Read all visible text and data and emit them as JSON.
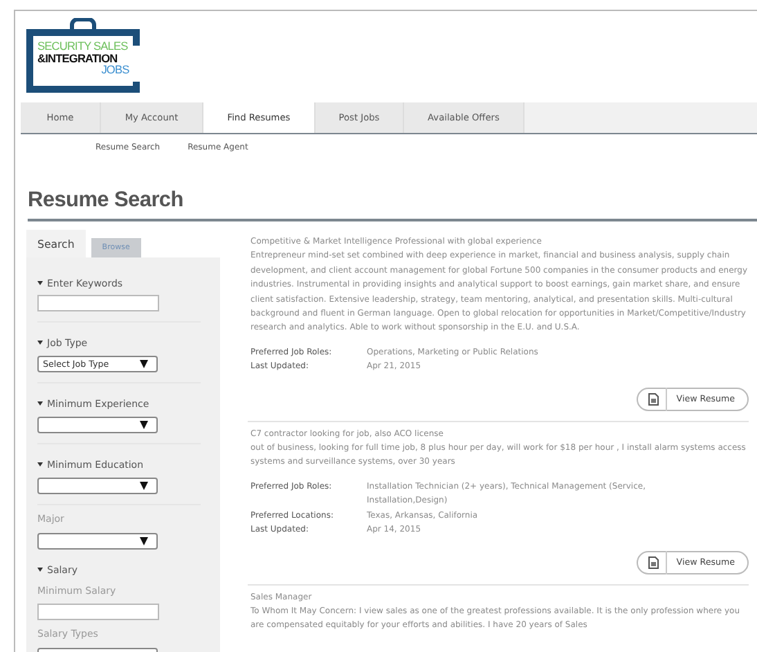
{
  "logo": {
    "line_1": "SECURITY SALES",
    "line_2": "&INTEGRATION",
    "line_3": "JOBS"
  },
  "nav": [
    {
      "label": "Home",
      "selected": false
    },
    {
      "label": "My Account",
      "selected": false
    },
    {
      "label": "Find Resumes",
      "selected": true
    },
    {
      "label": "Post Jobs",
      "selected": false
    },
    {
      "label": "Available Offers",
      "selected": false
    }
  ],
  "subnav": [
    "Resume Search",
    "Resume Agent"
  ],
  "title": "Resume Search",
  "sidebar": {
    "tabs": [
      {
        "label": "Search",
        "selected": true
      },
      {
        "label": "Browse",
        "selected": false
      }
    ],
    "fields": [
      {
        "kind": "section",
        "label": "Enter Keywords"
      },
      {
        "kind": "input"
      },
      {
        "kind": "section",
        "label": "Job Type"
      },
      {
        "kind": "select",
        "value": "Select Job Type"
      },
      {
        "kind": "section",
        "label": "Minimum Experience"
      },
      {
        "kind": "select"
      },
      {
        "kind": "section",
        "label": "Minimum Education"
      },
      {
        "kind": "select"
      },
      {
        "kind": "sub",
        "label": "Major"
      },
      {
        "kind": "select"
      },
      {
        "kind": "section",
        "label": "Salary"
      },
      {
        "kind": "sub",
        "label": "Minimum Salary"
      },
      {
        "kind": "input"
      },
      {
        "kind": "sub",
        "label": "Salary Types"
      },
      {
        "kind": "select"
      }
    ]
  },
  "results": [
    {
      "headline": "Competitive & Market Intelligence Professional with global experience",
      "summary": "Entrepreneur mind-set set combined with deep experience in market, financial and business analysis, supply chain development, and client account management for global Fortune 500 companies in the consumer products and energy industries. Instrumental in providing insights and analytical support to boost earnings, gain market share, and ensure client satisfaction. Extensive leadership, strategy, team mentoring, analytical, and presentation skills. Multi-cultural background and fluent in German language. Open to global relocation for opportunities in Market/Competitive/Industry research and analytics. Able to work without sponsorship in the E.U. and U.S.A.",
      "details": [
        {
          "label": "Preferred Job Roles:",
          "value": "Operations, Marketing or Public Relations"
        },
        {
          "label": "Last Updated:",
          "value": "Apr 21, 2015"
        }
      ],
      "button": "View Resume"
    },
    {
      "headline": "C7 contractor looking for job, also ACO license",
      "summary": "out of business, looking for full time job, 8 plus hour per day, will work for $18 per hour , I install alarm systems access systems and surveillance systems, over 30 years",
      "details": [
        {
          "label": "Preferred Job Roles:",
          "value": "Installation Technician (2+ years), Technical Management (Service, Installation,Design)"
        },
        {
          "label": "Preferred Locations:",
          "value": "Texas, Arkansas, California"
        },
        {
          "label": "Last Updated:",
          "value": "Apr 14, 2015"
        }
      ],
      "button": "View Resume"
    },
    {
      "headline": "Sales Manager",
      "summary": "To Whom It May Concern: I view sales as one of the greatest professions available. It is the only profession where you are compensated equitably for your efforts and abilities. I have 20 years of Sales"
    }
  ]
}
